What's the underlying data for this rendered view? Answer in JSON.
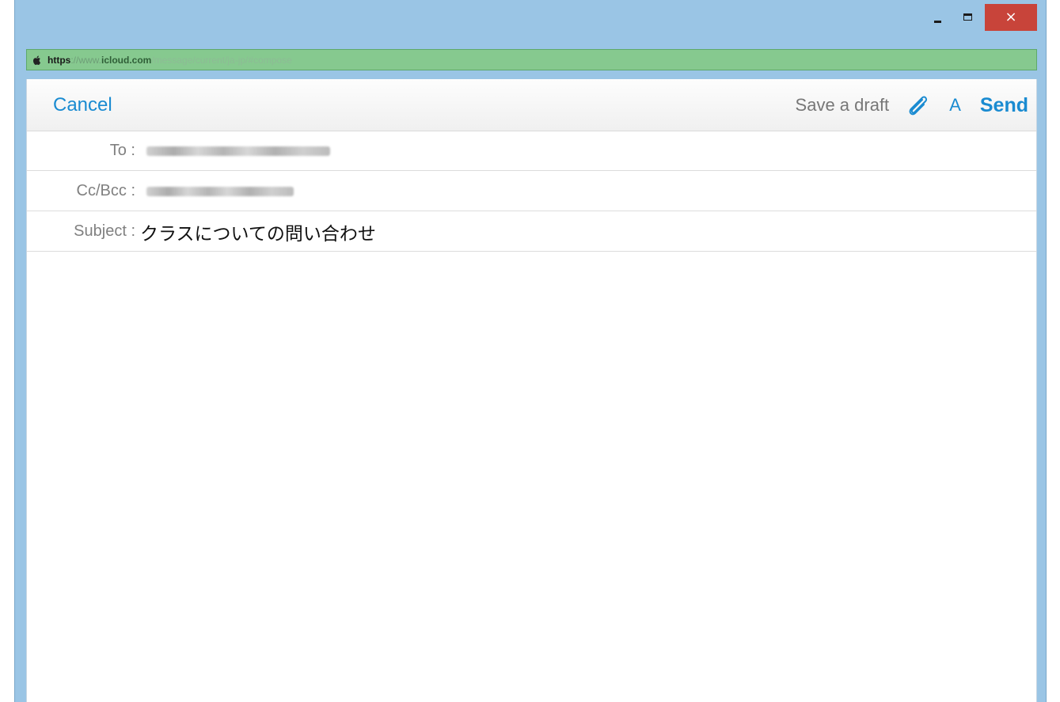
{
  "window": {
    "minimize_label": "minimize",
    "maximize_label": "maximize",
    "close_glyph": "×"
  },
  "address_bar": {
    "icon": "apple-icon",
    "scheme": "https",
    "separator": "://www.",
    "domain": "icloud.com",
    "path": "/message/current/ja-jp/#compose"
  },
  "toolbar": {
    "cancel_label": "Cancel",
    "save_draft_label": "Save a draft",
    "attach_icon": "paperclip-icon",
    "format_label": "A",
    "send_label": "Send"
  },
  "fields": {
    "to_label": "To :",
    "cc_label": "Cc/Bcc :",
    "subject_label": "Subject :",
    "subject_value": "クラスについての問い合わせ"
  },
  "colors": {
    "accent": "#1a8bd1",
    "window_frame": "#9ac5e5",
    "address_bar": "#86c98f",
    "close_button": "#c8443a"
  }
}
